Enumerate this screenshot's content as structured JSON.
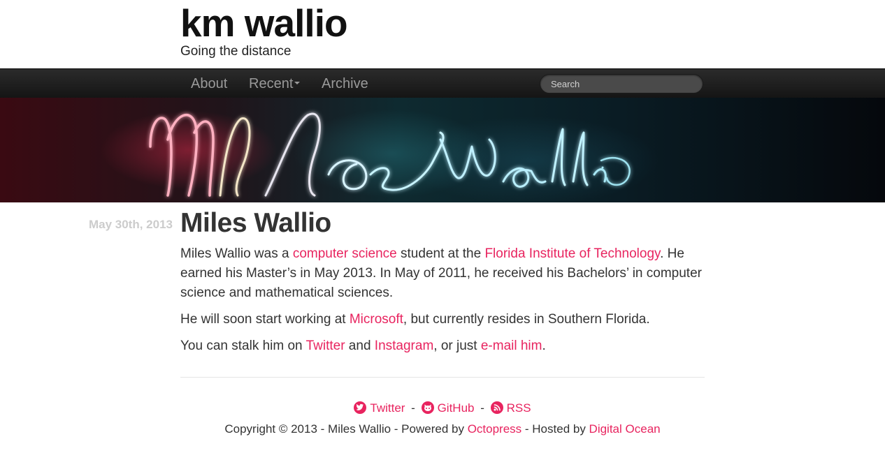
{
  "header": {
    "title": "km wallio",
    "subtitle": "Going the distance"
  },
  "nav": {
    "items": [
      {
        "label": "About"
      },
      {
        "label": "Recent"
      },
      {
        "label": "Archive"
      }
    ],
    "search_placeholder": "Search"
  },
  "post": {
    "date": "May 30th, 2013",
    "title": "Miles Wallio",
    "p1": {
      "t1": "Miles Wallio was a ",
      "link1": "computer science",
      "t2": " student at the ",
      "link2": "Florida Institute of Technology",
      "t3": ". He earned his Master’s in May 2013. In May of 2011, he received his Bachelors’ in computer science and mathematical sciences."
    },
    "p2": {
      "t1": "He will soon start working at ",
      "link1": "Microsoft",
      "t2": ", but currently resides in Southern Florida."
    },
    "p3": {
      "t1": "You can stalk him on ",
      "link1": "Twitter",
      "t2": " and ",
      "link2": "Instagram",
      "t3": ", or just ",
      "link3": "e-mail him",
      "t4": "."
    }
  },
  "footer": {
    "social": [
      {
        "label": "Twitter",
        "icon": "twitter-icon"
      },
      {
        "label": "GitHub",
        "icon": "github-icon"
      },
      {
        "label": "RSS",
        "icon": "rss-icon"
      }
    ],
    "separator": "-",
    "copy_t1": "Copyright © 2013 - Miles Wallio - Powered by ",
    "copy_link1": "Octopress",
    "copy_t2": " - Hosted by ",
    "copy_link2": "Digital Ocean"
  },
  "colors": {
    "accent": "#e8245f",
    "navbar": "#1b1b1b",
    "date": "#cccccc"
  }
}
